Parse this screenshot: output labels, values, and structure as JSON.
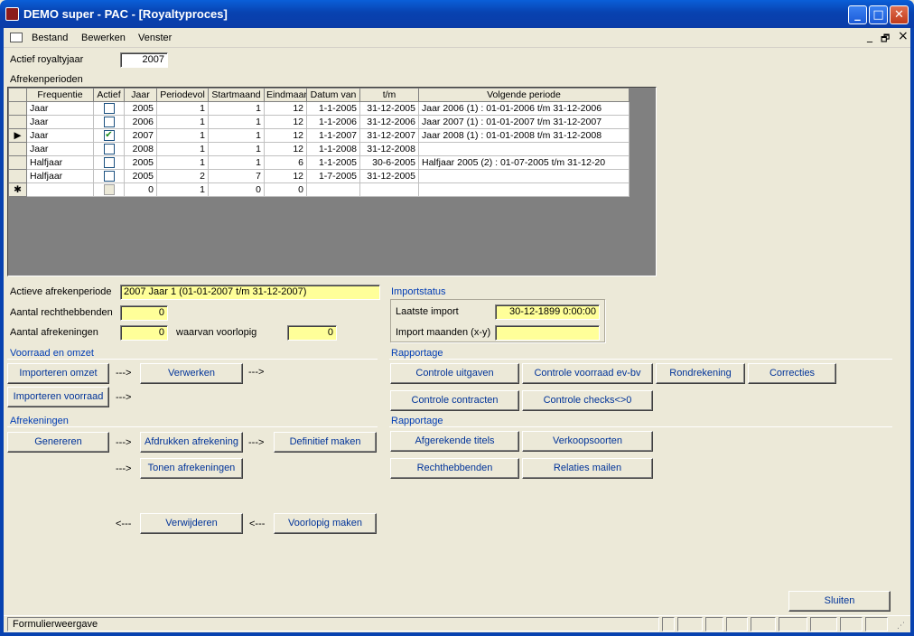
{
  "window": {
    "title": "DEMO super - PAC - [Royaltyproces]"
  },
  "menu": {
    "items": [
      "Bestand",
      "Bewerken",
      "Venster"
    ],
    "restore": "🗗",
    "minimize": "_",
    "close": "×"
  },
  "royaltyjaar": {
    "label": "Actief royaltyjaar",
    "value": "2007"
  },
  "afrekenperioden": {
    "label": "Afrekenperioden",
    "columns": [
      "Frequentie",
      "Actief",
      "Jaar",
      "Periodevol",
      "Startmaand",
      "Eindmaan",
      "Datum van",
      "t/m",
      "Volgende periode"
    ],
    "rows": [
      {
        "frequentie": "Jaar",
        "actief": false,
        "jaar": "2005",
        "periode": "1",
        "start": "1",
        "eind": "12",
        "van": "1-1-2005",
        "tm": "31-12-2005",
        "volgende": "Jaar 2006 (1) : 01-01-2006 t/m 31-12-2006",
        "current": false
      },
      {
        "frequentie": "Jaar",
        "actief": false,
        "jaar": "2006",
        "periode": "1",
        "start": "1",
        "eind": "12",
        "van": "1-1-2006",
        "tm": "31-12-2006",
        "volgende": "Jaar 2007 (1) : 01-01-2007 t/m 31-12-2007",
        "current": false
      },
      {
        "frequentie": "Jaar",
        "actief": true,
        "jaar": "2007",
        "periode": "1",
        "start": "1",
        "eind": "12",
        "van": "1-1-2007",
        "tm": "31-12-2007",
        "volgende": "Jaar 2008 (1) : 01-01-2008 t/m 31-12-2008",
        "current": true
      },
      {
        "frequentie": "Jaar",
        "actief": false,
        "jaar": "2008",
        "periode": "1",
        "start": "1",
        "eind": "12",
        "van": "1-1-2008",
        "tm": "31-12-2008",
        "volgende": "",
        "current": false
      },
      {
        "frequentie": "Halfjaar",
        "actief": false,
        "jaar": "2005",
        "periode": "1",
        "start": "1",
        "eind": "6",
        "van": "1-1-2005",
        "tm": "30-6-2005",
        "volgende": "Halfjaar 2005 (2) : 01-07-2005 t/m 31-12-20",
        "current": false
      },
      {
        "frequentie": "Halfjaar",
        "actief": false,
        "jaar": "2005",
        "periode": "2",
        "start": "7",
        "eind": "12",
        "van": "1-7-2005",
        "tm": "31-12-2005",
        "volgende": "",
        "current": false
      }
    ],
    "newrow": {
      "marker": "✱",
      "jaar": "0",
      "periode": "1",
      "start": "0",
      "eind": "0"
    }
  },
  "actieve_periode": {
    "label": "Actieve afrekenperiode",
    "value": "2007 Jaar 1 (01-01-2007 t/m 31-12-2007)"
  },
  "rechthebbenden": {
    "label": "Aantal rechthebbenden",
    "value": "0"
  },
  "afrekeningen": {
    "label": "Aantal afrekeningen",
    "value": "0",
    "voorlopig_label": "waarvan voorlopig",
    "voorlopig_value": "0"
  },
  "importstatus": {
    "title": "Importstatus",
    "laatste_label": "Laatste import",
    "laatste_value": "30-12-1899 0:00:00",
    "maanden_label": "Import maanden (x-y)",
    "maanden_value": ""
  },
  "voorraad": {
    "title": "Voorraad en omzet",
    "importeren_omzet": "Importeren omzet",
    "verwerken": "Verwerken",
    "importeren_voorraad": "Importeren voorraad"
  },
  "afrekeningen_sectie": {
    "title": "Afrekeningen",
    "genereren": "Genereren",
    "afdrukken": "Afdrukken afrekening",
    "definitief": "Definitief maken",
    "tonen": "Tonen afrekeningen",
    "verwijderen": "Verwijderen",
    "voorlopig": "Voorlopig maken"
  },
  "arrows": {
    "right": "--->",
    "left": "<---"
  },
  "rapportage1": {
    "title": "Rapportage",
    "controle_uitgaven": "Controle uitgaven",
    "controle_voorraad": "Controle voorraad ev-bv",
    "rondrekening": "Rondrekening",
    "correcties": "Correcties",
    "controle_contracten": "Controle contracten",
    "controle_checks": "Controle checks<>0"
  },
  "rapportage2": {
    "title": "Rapportage",
    "afgerekende_titels": "Afgerekende titels",
    "verkoopsoorten": "Verkoopsoorten",
    "rechthebbenden": "Rechthebbenden",
    "relaties_mailen": "Relaties mailen"
  },
  "sluiten": "Sluiten",
  "status": "Formulierweergave"
}
